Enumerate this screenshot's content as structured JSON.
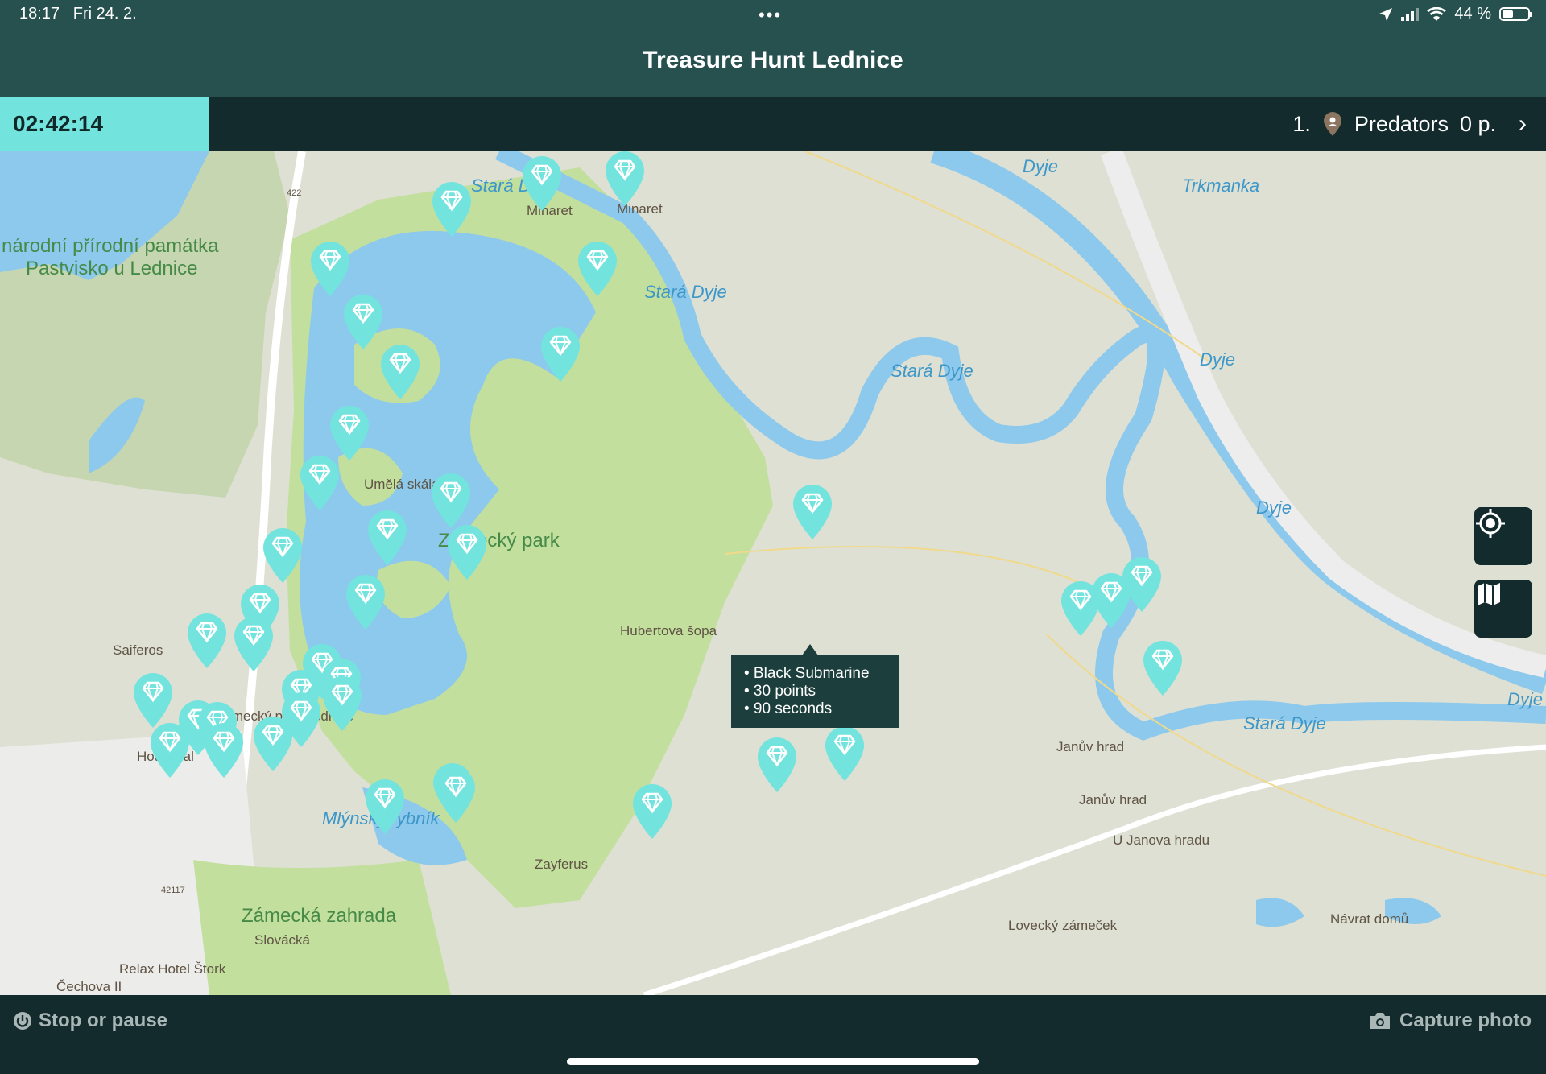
{
  "status_bar": {
    "time": "18:17",
    "date": "Fri 24. 2.",
    "battery": "44 %"
  },
  "header": {
    "title": "Treasure Hunt Lednice"
  },
  "info_bar": {
    "timer": "02:42:14",
    "rank": "1.",
    "team": "Predators",
    "points": "0 p."
  },
  "map": {
    "labels": {
      "reserve_1": "národní přírodní památka",
      "reserve_2": "Pastvisko u Lednice",
      "minaret_1": "Minaret",
      "minaret_2": "Minaret",
      "umela_skala": "Umělá skála",
      "zamecky_park": "Zámecký park",
      "hubertova": "Hubertova šopa",
      "saiferos": "Saiferos",
      "zamecky_park_lednice": "Zámecký park Lednice",
      "hotel_gal": "Hotel Gal",
      "mlynsky": "Mlýnský rybník",
      "zayferus": "Zayferus",
      "zamecka_zahrada": "Zámecká zahrada",
      "slovacka": "Slovácká",
      "relax_hotel": "Relax Hotel Štork",
      "cechova": "Čechova II",
      "januv_hrad_top": "Janův hrad",
      "januv_hrad": "Janův hrad",
      "u_janova_hradu": "U Janova hradu",
      "lovecky": "Lovecký zámeček",
      "navrat": "Návrat domů",
      "stara_dyje_1": "Stará Dyje",
      "stara_dyje_2": "Stará Dyje",
      "stara_dyje_3": "Stará Dyje",
      "stara_dyje_4": "Stará Dyje",
      "dyje_1": "Dyje",
      "dyje_2": "Dyje",
      "dyje_3": "Dyje",
      "dyje_4": "Dyje",
      "trkmanka": "Trkmanka",
      "road_422": "422",
      "road_42117": "42117"
    },
    "tooltip": {
      "line1": "• Black Submarine",
      "line2": "• 30 points",
      "line3": "• 90 seconds"
    }
  },
  "bottom_bar": {
    "stop_label": "Stop or pause",
    "capture_label": "Capture photo"
  },
  "colors": {
    "header": "#27514f",
    "bar_dark": "#132b2c",
    "accent": "#73e3de",
    "water": "#8cc9ec",
    "park": "#c3df9e"
  }
}
